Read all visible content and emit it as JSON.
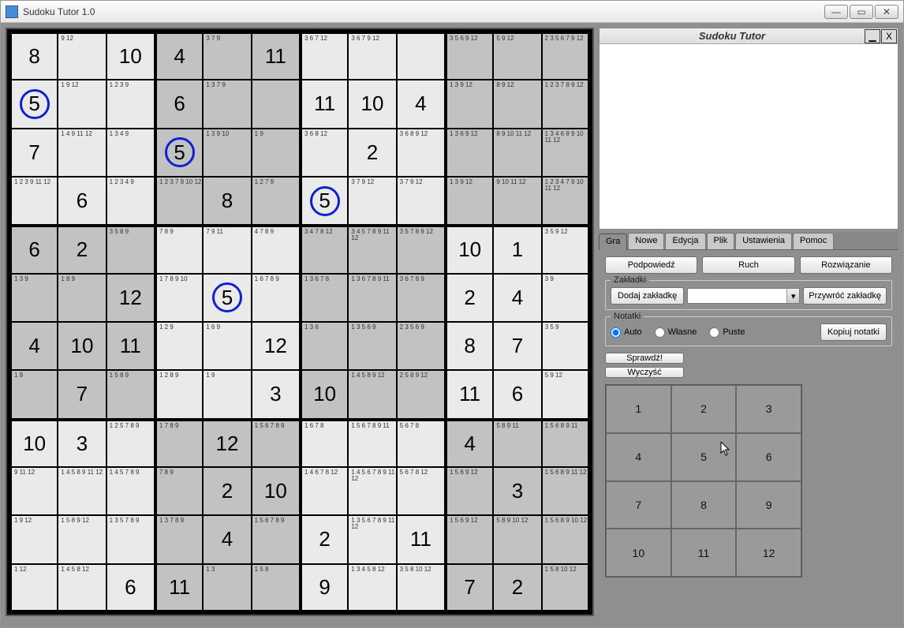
{
  "window": {
    "title": "Sudoku Tutor 1.0"
  },
  "panel": {
    "title": "Sudoku Tutor",
    "close": "X"
  },
  "tabs": [
    "Gra",
    "Nowe",
    "Edycja",
    "Plik",
    "Ustawienia",
    "Pomoc"
  ],
  "active_tab": 0,
  "buttons": {
    "hint": "Podpowiedź",
    "move": "Ruch",
    "solve": "Rozwiązanie",
    "add_bookmark": "Dodaj zakładkę",
    "restore_bookmark": "Przywróć zakładkę",
    "copy_notes": "Kopiuj notatki",
    "check": "Sprawdź!",
    "clear": "Wyczyść"
  },
  "groups": {
    "bookmarks": "Zakładki",
    "notes": "Notatki"
  },
  "radios": {
    "auto": "Auto",
    "own": "Własne",
    "empty": "Puste"
  },
  "numpad": [
    "1",
    "2",
    "3",
    "4",
    "5",
    "6",
    "7",
    "8",
    "9",
    "10",
    "11",
    "12"
  ],
  "grid": [
    [
      {
        "v": "8"
      },
      {
        "n": "9 12"
      },
      {
        "v": "10"
      },
      {
        "v": "4"
      },
      {
        "n": "3 7 9"
      },
      {
        "v": "11"
      },
      {
        "n": "3 6 7 12"
      },
      {
        "n": "3 6 7 9 12"
      },
      {},
      {
        "n": "3 5 6 9 12"
      },
      {
        "n": "5 9 12"
      },
      {
        "n": "2 3 5 6 7 9 12"
      }
    ],
    [
      {
        "v": "5",
        "c": true
      },
      {
        "n": "1 9 12"
      },
      {
        "n": "1 2 3 9"
      },
      {
        "v": "6"
      },
      {
        "n": "1 3 7 9"
      },
      {},
      {
        "v": "11"
      },
      {
        "v": "10"
      },
      {
        "v": "4"
      },
      {
        "n": "1 3 9 12"
      },
      {
        "n": "8 9 12"
      },
      {
        "n": "1 2 3 7 8 9 12"
      }
    ],
    [
      {
        "v": "7"
      },
      {
        "n": "1 4 9 11 12"
      },
      {
        "n": "1 3 4 9"
      },
      {
        "v": "5",
        "c": true
      },
      {
        "n": "1 3 9 10"
      },
      {
        "n": "1 9"
      },
      {
        "n": "3 6 8 12"
      },
      {
        "v": "2"
      },
      {
        "n": "3 6 8 9 12"
      },
      {
        "n": "1 3 6 9 12"
      },
      {
        "n": "8 9 10 11 12"
      },
      {
        "n": "1 3 4 6 8 9 10 11 12"
      }
    ],
    [
      {
        "n": "1 2 3 9 11 12"
      },
      {
        "v": "6"
      },
      {
        "n": "1 2 3 4 9"
      },
      {
        "n": "1 2 3 7 9 10 12"
      },
      {
        "v": "8"
      },
      {
        "n": "1 2 7 9"
      },
      {
        "v": "5",
        "c": true
      },
      {
        "n": "3 7 9 12"
      },
      {
        "n": "3 7 9 12"
      },
      {
        "n": "1 3 9 12"
      },
      {
        "n": "9 10 11 12"
      },
      {
        "n": "1 2 3 4 7 9 10 11 12"
      }
    ],
    [
      {
        "v": "6"
      },
      {
        "v": "2"
      },
      {
        "n": "3 5 8 9"
      },
      {
        "n": "7 8 9"
      },
      {
        "n": "7 9 11"
      },
      {
        "n": "4 7 8 9"
      },
      {
        "n": "3 4 7 8 12"
      },
      {
        "n": "3 4 5 7 8 9 11 12"
      },
      {
        "n": "3 5 7 8 9 12"
      },
      {
        "v": "10"
      },
      {
        "v": "1"
      },
      {
        "n": "3 5 9 12"
      }
    ],
    [
      {
        "n": "1 3 9"
      },
      {
        "n": "1 8 9"
      },
      {
        "v": "12"
      },
      {
        "n": "1 7 8 9 10"
      },
      {
        "v": "5",
        "c": true
      },
      {
        "n": "1 6 7 8 9"
      },
      {
        "n": "1 3 6 7 8"
      },
      {
        "n": "1 3 6 7 8 9 11"
      },
      {
        "n": "3 6 7 8 9"
      },
      {
        "v": "2"
      },
      {
        "v": "4"
      },
      {
        "n": "3 9"
      }
    ],
    [
      {
        "v": "4"
      },
      {
        "v": "10"
      },
      {
        "v": "11"
      },
      {
        "n": "1 2 9"
      },
      {
        "n": "1 6 9"
      },
      {
        "v": "12"
      },
      {
        "n": "1 3 6"
      },
      {
        "n": "1 3 5 6 9"
      },
      {
        "n": "2 3 5 6 9"
      },
      {
        "v": "8"
      },
      {
        "v": "7"
      },
      {
        "n": "3 5 9"
      }
    ],
    [
      {
        "n": "1 9"
      },
      {
        "v": "7"
      },
      {
        "n": "1 5 8 9"
      },
      {
        "n": "1 2 8 9"
      },
      {
        "n": "1 9"
      },
      {
        "v": "3"
      },
      {
        "v": "10"
      },
      {
        "n": "1 4 5 8 9 12"
      },
      {
        "n": "2 5 8 9 12"
      },
      {
        "v": "11"
      },
      {
        "v": "6"
      },
      {
        "n": "5 9 12"
      }
    ],
    [
      {
        "v": "10"
      },
      {
        "v": "3"
      },
      {
        "n": "1 2 5 7 8 9"
      },
      {
        "n": "1 7 8 9"
      },
      {
        "v": "12"
      },
      {
        "n": "1 5 6 7 8 9"
      },
      {
        "n": "1 6 7 8"
      },
      {
        "n": "1 5 6 7 8 9 11"
      },
      {
        "n": "5 6 7 8"
      },
      {
        "v": "4"
      },
      {
        "n": "5 8 9 11"
      },
      {
        "n": "1 5 6 8 9 11"
      }
    ],
    [
      {
        "n": "9 11 12"
      },
      {
        "n": "1 4 5 8 9 11 12"
      },
      {
        "n": "1 4 5 7 8 9"
      },
      {
        "n": "7 8 9"
      },
      {
        "v": "2"
      },
      {
        "v": "10"
      },
      {
        "n": "1 4 6 7 8 12"
      },
      {
        "n": "1 4 5 6 7 8 9 11 12"
      },
      {
        "n": "5 6 7 8 12"
      },
      {
        "n": "1 5 6 9 12"
      },
      {
        "v": "3"
      },
      {
        "n": "1 5 6 8 9 11 12"
      }
    ],
    [
      {
        "n": "1 9 12"
      },
      {
        "n": "1 5 8 9 12"
      },
      {
        "n": "1 3 5 7 8 9"
      },
      {
        "n": "1 3 7 8 9"
      },
      {
        "v": "4"
      },
      {
        "n": "1 5 6 7 8 9"
      },
      {
        "v": "2"
      },
      {
        "n": "1 3 5 6 7 8 9 11 12"
      },
      {
        "v": "11"
      },
      {
        "n": "1 5 6 9 12"
      },
      {
        "n": "5 8 9 10 12"
      },
      {
        "n": "1 5 6 8 9 10 12"
      }
    ],
    [
      {
        "n": "1 12"
      },
      {
        "n": "1 4 5 8 12"
      },
      {
        "v": "6"
      },
      {
        "v": "11"
      },
      {
        "n": "1 3"
      },
      {
        "n": "1 5 8"
      },
      {
        "v": "9"
      },
      {
        "n": "1 3 4 5 8 12"
      },
      {
        "n": "3 5 8 10 12"
      },
      {
        "v": "7"
      },
      {
        "v": "2"
      },
      {
        "n": "1 5 8 10 12"
      }
    ]
  ],
  "boxshade": [
    [
      0,
      0,
      0,
      1,
      1,
      1,
      0,
      0,
      0,
      1,
      1,
      1
    ],
    [
      0,
      0,
      0,
      1,
      1,
      1,
      0,
      0,
      0,
      1,
      1,
      1
    ],
    [
      0,
      0,
      0,
      1,
      1,
      1,
      0,
      0,
      0,
      1,
      1,
      1
    ],
    [
      0,
      0,
      0,
      1,
      1,
      1,
      0,
      0,
      0,
      1,
      1,
      1
    ],
    [
      1,
      1,
      1,
      0,
      0,
      0,
      1,
      1,
      1,
      0,
      0,
      0
    ],
    [
      1,
      1,
      1,
      0,
      0,
      0,
      1,
      1,
      1,
      0,
      0,
      0
    ],
    [
      1,
      1,
      1,
      0,
      0,
      0,
      1,
      1,
      1,
      0,
      0,
      0
    ],
    [
      1,
      1,
      1,
      0,
      0,
      0,
      1,
      1,
      1,
      0,
      0,
      0
    ],
    [
      0,
      0,
      0,
      1,
      1,
      1,
      0,
      0,
      0,
      1,
      1,
      1
    ],
    [
      0,
      0,
      0,
      1,
      1,
      1,
      0,
      0,
      0,
      1,
      1,
      1
    ],
    [
      0,
      0,
      0,
      1,
      1,
      1,
      0,
      0,
      0,
      1,
      1,
      1
    ],
    [
      0,
      0,
      0,
      1,
      1,
      1,
      0,
      0,
      0,
      1,
      1,
      1
    ]
  ]
}
